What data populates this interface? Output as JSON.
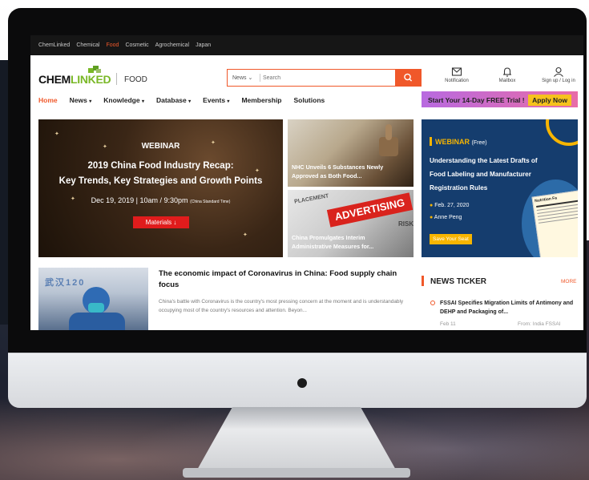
{
  "topbar": {
    "items": [
      "ChemLinked",
      "Chemical",
      "Food",
      "Cosmetic",
      "Agrochemical",
      "Japan"
    ],
    "active": "Food"
  },
  "header": {
    "logo_chem": "CHEM",
    "logo_linked": "LINKED",
    "section": "FOOD",
    "search_category": "News",
    "search_placeholder": "Search",
    "notification": "Notification",
    "mailbox": "Mailbox",
    "signup": "Sign up / Log in"
  },
  "nav": {
    "items": [
      "Home",
      "News",
      "Knowledge",
      "Database",
      "Events",
      "Membership",
      "Solutions"
    ],
    "trial_text": "Start Your 14-Day FREE Trial !",
    "trial_button": "Apply Now"
  },
  "hero": {
    "tag": "WEBINAR",
    "title1": "2019 China Food Industry Recap:",
    "title2": "Key Trends, Key Strategies and Growth Points",
    "date": "Dec 19, 2019 | 10am / 9:30pm",
    "timezone": "(China Standard Time)",
    "materials": "Materials"
  },
  "cards": [
    {
      "caption1": "NHC Unveils 6 Substances Newly",
      "caption2": "Approved as Both Food..."
    },
    {
      "caption1": "China Promulgates Interim",
      "caption2": "Administrative Measures for...",
      "sign_word": "ADVERTISING",
      "sign_word2": "PLACEMENT",
      "sign_word3": "RISK"
    }
  ],
  "webinar": {
    "label": "WEBINAR",
    "free": "(Free)",
    "line1": "Understanding the Latest Drafts of",
    "line2": "Food Labeling and Manufacturer",
    "line3": "Registration Rules",
    "date": "Feb. 27, 2020",
    "speaker": "Anne Peng",
    "seat": "Save Your Seat",
    "label_text": "Nutrition Fa"
  },
  "article": {
    "title": "The economic impact of Coronavirus in China: Food supply chain focus",
    "body": "China's battle with Coronavirus is the country's most pressing concern at the moment and is understandably occupying most of the country's resources and attention. Beyon...",
    "thumb_text": "武汉120"
  },
  "ticker": {
    "heading": "NEWS TICKER",
    "more": "MORE",
    "item_title": "FSSAI Specifies Migration Limits of Antimony and DEHP and Packaging of...",
    "item_date": "Feb 11",
    "item_source": "From: India FSSAI"
  },
  "colors": {
    "accent": "#f0582a",
    "brand_green": "#7ab827",
    "webinar_blue": "#153d6e",
    "trial_gold": "#f6c21c"
  }
}
